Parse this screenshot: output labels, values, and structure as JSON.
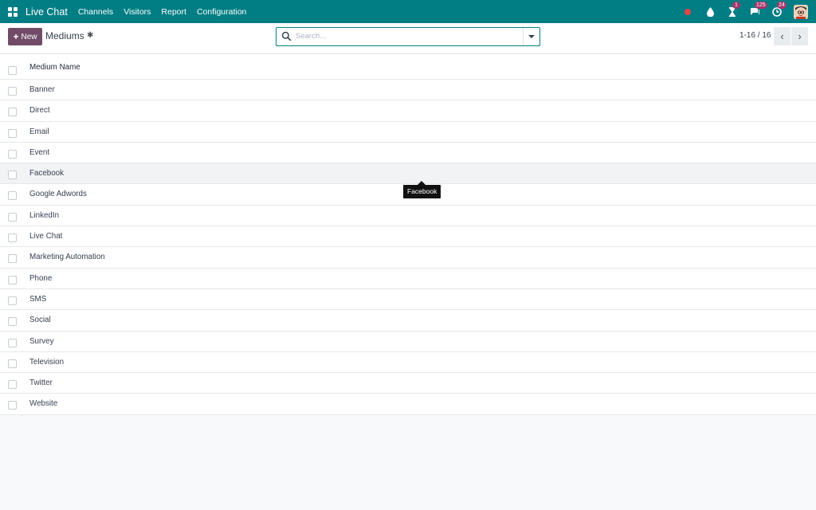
{
  "navbar": {
    "app_name": "Live Chat",
    "menu": [
      "Channels",
      "Visitors",
      "Report",
      "Configuration"
    ],
    "systray": {
      "activity_badge": "1",
      "messages_badge": "125",
      "timer_badge": "24"
    }
  },
  "control": {
    "new_label": "New",
    "title": "Mediums",
    "search_placeholder": "Search...",
    "pager": "1-16 / 16"
  },
  "list": {
    "column_header": "Medium Name",
    "rows": [
      "Banner",
      "Direct",
      "Email",
      "Event",
      "Facebook",
      "Google Adwords",
      "LinkedIn",
      "Live Chat",
      "Marketing Automation",
      "Phone",
      "SMS",
      "Social",
      "Survey",
      "Television",
      "Twitter",
      "Website"
    ]
  },
  "tooltip": "Facebook",
  "colors": {
    "navbar": "#017e84",
    "primary_button": "#714b67",
    "badge": "#a4376a"
  }
}
